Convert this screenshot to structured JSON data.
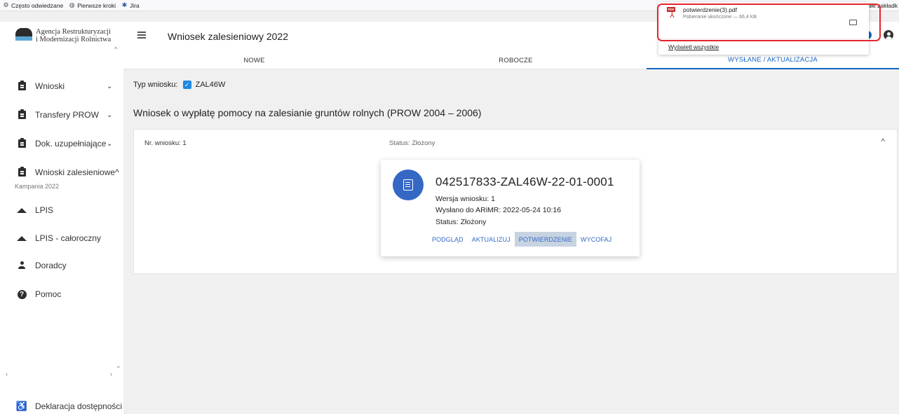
{
  "bookmarks": {
    "items": [
      {
        "label": "Często odwiedzane",
        "icon": "gear-icon"
      },
      {
        "label": "Pierwsze kroki",
        "icon": "globe-icon"
      },
      {
        "label": "Jira",
        "icon": "jira-icon"
      }
    ],
    "right_label": "stałe zakładk"
  },
  "sidebar": {
    "logo_line1": "Agencja Restrukturyzacji",
    "logo_line2": "i Modernizacji Rolnictwa",
    "items": [
      {
        "label": "Wnioski",
        "icon": "clipboard-icon",
        "chevron": "⌄"
      },
      {
        "label": "Transfery PROW",
        "icon": "clipboard-icon",
        "chevron": "⌄"
      },
      {
        "label": "Dok. uzupełniające",
        "icon": "clipboard-icon",
        "chevron": "⌄"
      },
      {
        "label": "Wnioski zalesieniowe",
        "icon": "clipboard-icon",
        "chevron": "^"
      },
      {
        "label": "LPIS",
        "icon": "mountain-icon"
      },
      {
        "label": "LPIS - całoroczny",
        "icon": "mountain-icon"
      },
      {
        "label": "Doradcy",
        "icon": "person-icon"
      },
      {
        "label": "Pomoc",
        "icon": "help-icon"
      }
    ],
    "sub_item": "Kampania 2022",
    "accessibility_label": "Deklaracja dostępności"
  },
  "header": {
    "title": "Wniosek zalesieniowy 2022"
  },
  "tabs": [
    {
      "label": "NOWE",
      "active": false
    },
    {
      "label": "ROBOCZE",
      "active": false
    },
    {
      "label": "WYSŁANE / AKTUALIZACJA",
      "active": true
    }
  ],
  "main": {
    "type_label": "Typ wniosku:",
    "type_value": "ZAL46W",
    "section_title": "Wniosek o wypłatę pomocy na zalesianie gruntów rolnych (PROW 2004 – 2006)",
    "panel": {
      "number_label": "Nr. wniosku: 1",
      "status_label": "Status: Złożony"
    },
    "card": {
      "id": "042517833-ZAL46W-22-01-0001",
      "version": "Wersja wniosku: 1",
      "sent": "Wysłano do ARiMR: 2022-05-24 10:16",
      "status": "Status: Złożony",
      "actions": [
        "PODGLĄD",
        "AKTUALIZUJ",
        "POTWIERDZENIE",
        "WYCOFAJ"
      ],
      "selected_action": "POTWIERDZENIE"
    }
  },
  "download": {
    "file_name": "potwierdzenie(3).pdf",
    "meta": "Pobieranie ukończone — 66,4 KB",
    "show_all": "Wyświetl wszystkie",
    "badge": "PDF"
  },
  "colors": {
    "accent": "#1565c0",
    "card_icon": "#3568c4",
    "highlight": "#e3262e",
    "selected_action_bg": "#c8d3e2"
  }
}
